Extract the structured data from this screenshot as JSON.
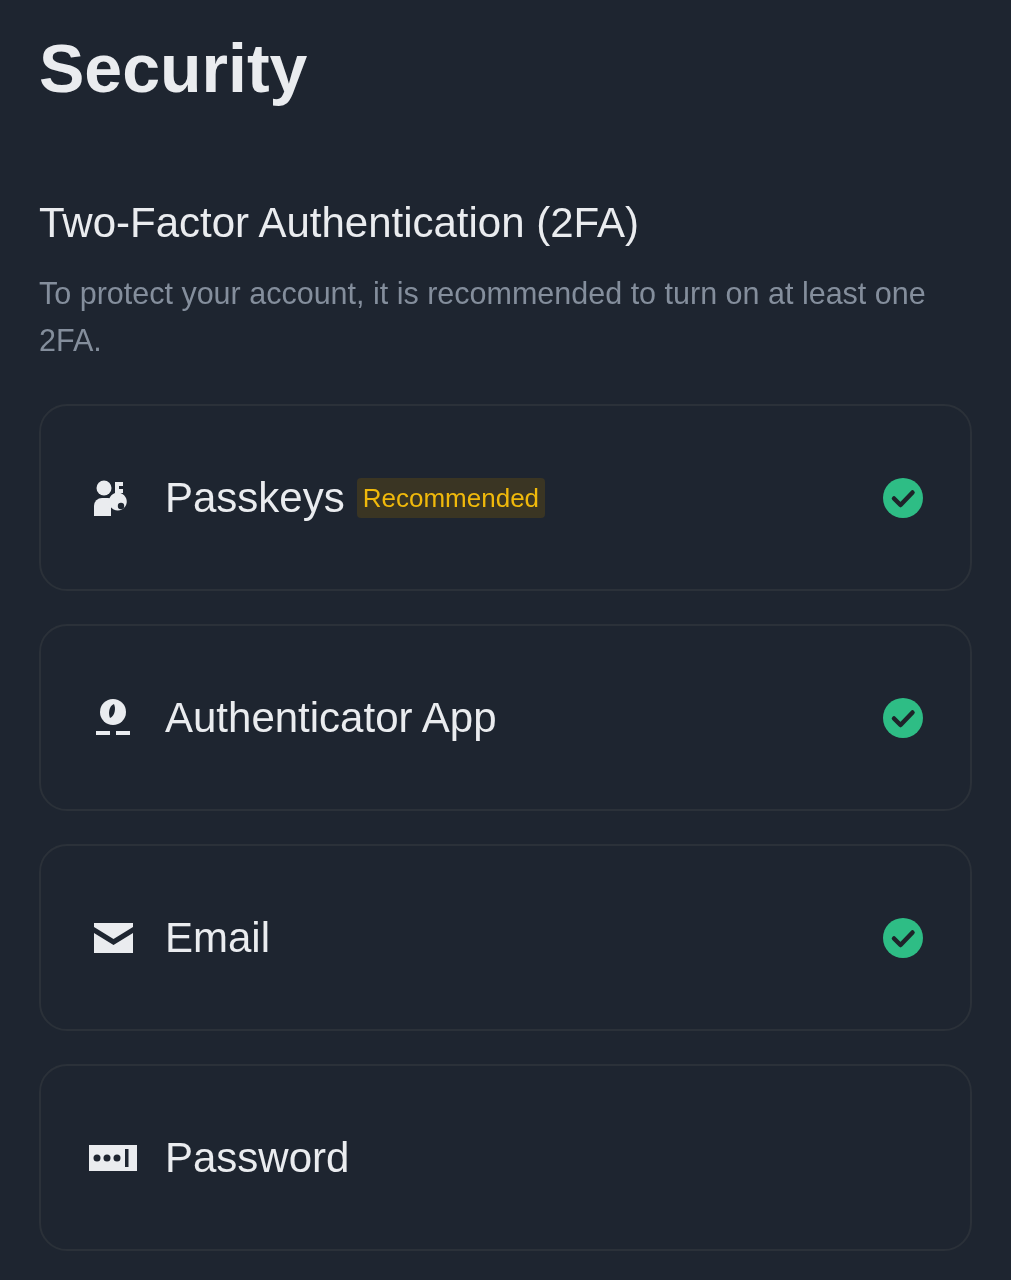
{
  "page": {
    "title": "Security"
  },
  "section": {
    "title": "Two-Factor Authentication (2FA)",
    "description": "To protect your account, it is recommended to turn on at least one 2FA."
  },
  "methods": [
    {
      "kind": "passkeys",
      "label": "Passkeys",
      "badge": "Recommended",
      "enabled": true
    },
    {
      "kind": "authenticator",
      "label": "Authenticator App",
      "enabled": true
    },
    {
      "kind": "email",
      "label": "Email",
      "enabled": true
    },
    {
      "kind": "password",
      "label": "Password",
      "enabled": false
    }
  ]
}
